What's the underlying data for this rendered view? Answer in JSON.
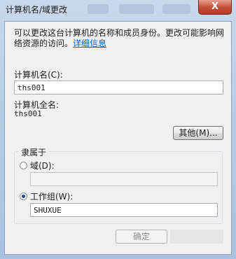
{
  "window": {
    "title": "计算机名/域更改",
    "close_glyph": "X"
  },
  "description": {
    "text": "可以更改这台计算机的名称和成员身份。更改可能影响网络资源的访问。",
    "link": "详细信息"
  },
  "computer_name": {
    "label": "计算机名(C):",
    "value": "ths001"
  },
  "full_name": {
    "label": "计算机全名:",
    "value": "ths001"
  },
  "more_button": "其他(M)...",
  "member_of": {
    "title": "隶属于",
    "domain_label": "域(D):",
    "domain_value": "",
    "domain_selected": false,
    "workgroup_label": "工作组(W):",
    "workgroup_value": "SHUXUE",
    "workgroup_selected": true
  },
  "ok_button": "确定"
}
